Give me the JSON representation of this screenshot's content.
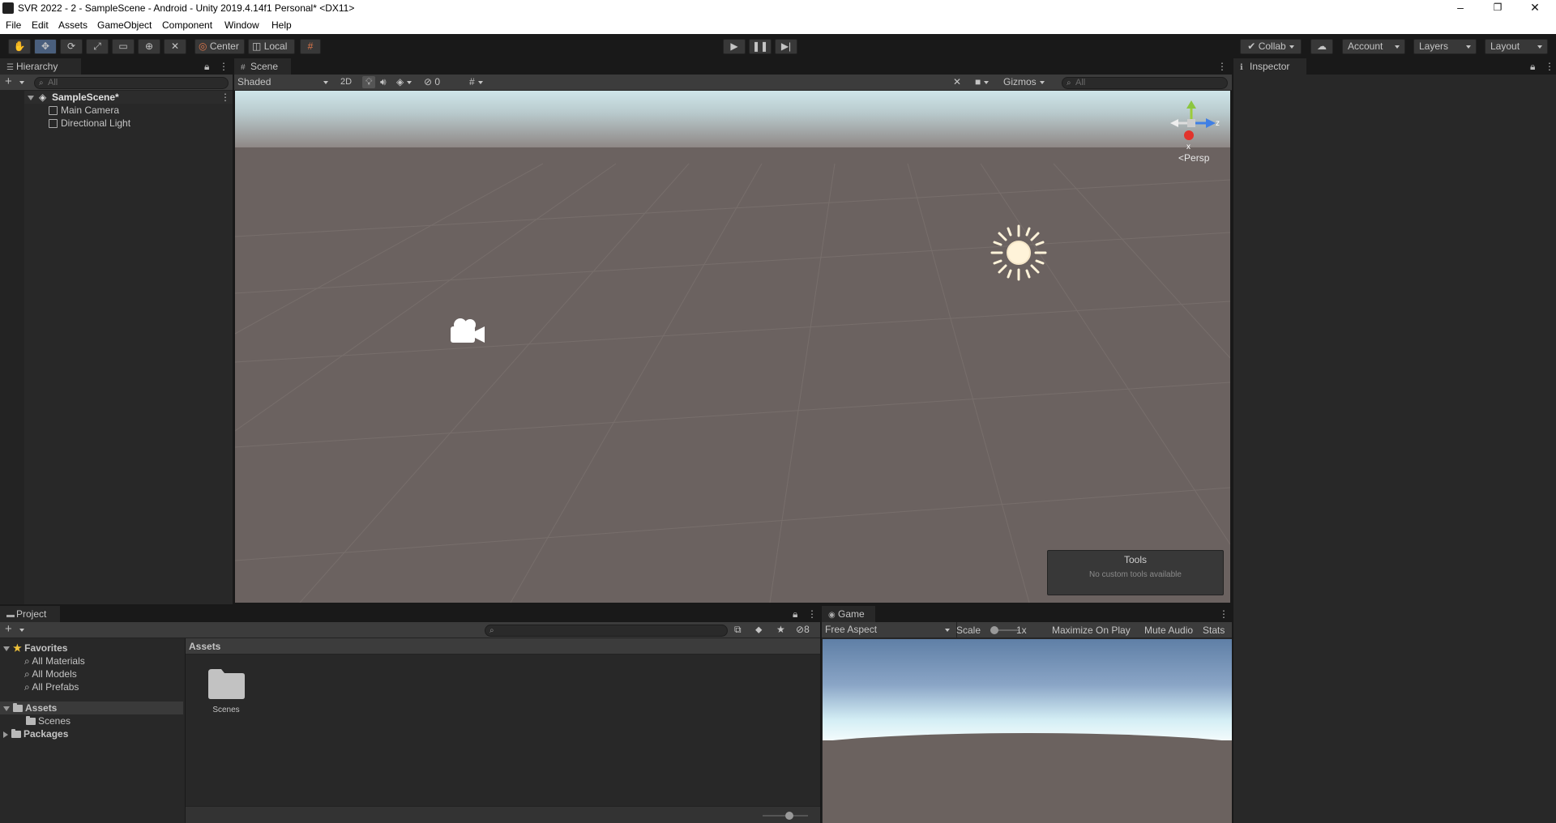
{
  "window": {
    "title": "SVR 2022 - 2 - SampleScene - Android - Unity 2019.4.14f1 Personal* <DX11>",
    "minimize": "–",
    "maximize": "❐",
    "close": "✕"
  },
  "menu": [
    "File",
    "Edit",
    "Assets",
    "GameObject",
    "Component",
    "Window",
    "Help"
  ],
  "toolbar": {
    "pivot": "Center",
    "space": "Local",
    "collab": "Collab",
    "account": "Account",
    "layers": "Layers",
    "layout": "Layout"
  },
  "hierarchy": {
    "tab": "Hierarchy",
    "search_placeholder": "All",
    "scene": "SampleScene*",
    "items": [
      "Main Camera",
      "Directional Light"
    ]
  },
  "scene": {
    "tab": "Scene",
    "shading": "Shaded",
    "mode_2d": "2D",
    "hidden_count": "0",
    "gizmos": "Gizmos",
    "search_placeholder": "All",
    "persp": "Persp",
    "axis_x": "x",
    "axis_z": "z",
    "tools_title": "Tools",
    "tools_message": "No custom tools available"
  },
  "inspector": {
    "tab": "Inspector"
  },
  "project": {
    "tab": "Project",
    "hidden_count": "8",
    "favorites": "Favorites",
    "favorite_items": [
      "All Materials",
      "All Models",
      "All Prefabs"
    ],
    "assets": "Assets",
    "asset_children": [
      "Scenes"
    ],
    "packages": "Packages",
    "breadcrumb": "Assets",
    "grid_items": [
      "Scenes"
    ],
    "zoom_level": 0.6
  },
  "game": {
    "tab": "Game",
    "aspect": "Free Aspect",
    "scale_label": "Scale",
    "scale_value": "1x",
    "maximize": "Maximize On Play",
    "mute": "Mute Audio",
    "stats": "Stats"
  },
  "colors": {
    "sky": "#cfe6ea",
    "ground": "#6b6260",
    "accent": "#4a5f7d"
  }
}
